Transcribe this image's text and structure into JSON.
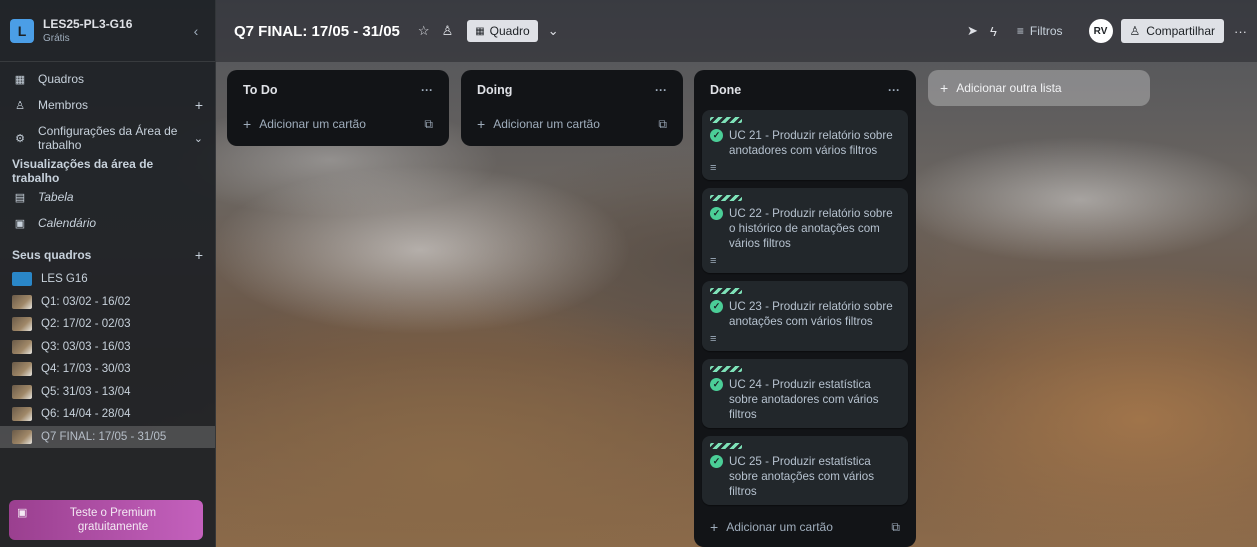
{
  "workspace": {
    "logo_letter": "L",
    "name": "LES25-PL3-G16",
    "plan": "Grátis",
    "collapse_icon": "chevron-left-icon"
  },
  "sidebar": {
    "boards_label": "Quadros",
    "members_label": "Membros",
    "settings_label_1": "Configurações da Área de",
    "settings_label_2": "trabalho",
    "views_title": "Visualizações da área de trabalho",
    "views": [
      "Tabela",
      "Calendário"
    ],
    "your_boards_title": "Seus quadros",
    "boards": [
      "LES G16",
      "Q1: 03/02 - 16/02",
      "Q2: 17/02 - 02/03",
      "Q3: 03/03 - 16/03",
      "Q4: 17/03 - 30/03",
      "Q5: 31/03 - 13/04",
      "Q6: 14/04 - 28/04",
      "Q7 FINAL: 17/05 - 31/05"
    ],
    "premium_line1": "Teste o Premium",
    "premium_line2": "gratuitamente"
  },
  "header": {
    "board_title": "Q7 FINAL: 17/05 - 31/05",
    "view_label": "Quadro",
    "filters_label": "Filtros",
    "avatar_initials": "RV",
    "share_label": "Compartilhar"
  },
  "lists": [
    {
      "title": "To Do",
      "add_label": "Adicionar um cartão",
      "cards": []
    },
    {
      "title": "Doing",
      "add_label": "Adicionar um cartão",
      "cards": []
    },
    {
      "title": "Done",
      "add_label": "Adicionar um cartão",
      "cards": [
        {
          "title": "UC 21 - Produzir relatório sobre anotadores com vários filtros"
        },
        {
          "title": "UC 22 - Produzir relatório sobre o histórico de anotações com vários filtros"
        },
        {
          "title": "UC 23 - Produzir relatório sobre anotações com vários filtros"
        },
        {
          "title": "UC 24 - Produzir estatística sobre anotadores com vários filtros"
        },
        {
          "title": "UC 25 - Produzir estatística sobre anotações com vários filtros"
        }
      ]
    }
  ],
  "add_list_label": "Adicionar outra lista",
  "colors": {
    "label_green": "#7ee2b8",
    "check_green": "#4bce97",
    "premium_purple": "#c461bd",
    "list_bg": "#121417",
    "card_bg": "#22272b"
  }
}
